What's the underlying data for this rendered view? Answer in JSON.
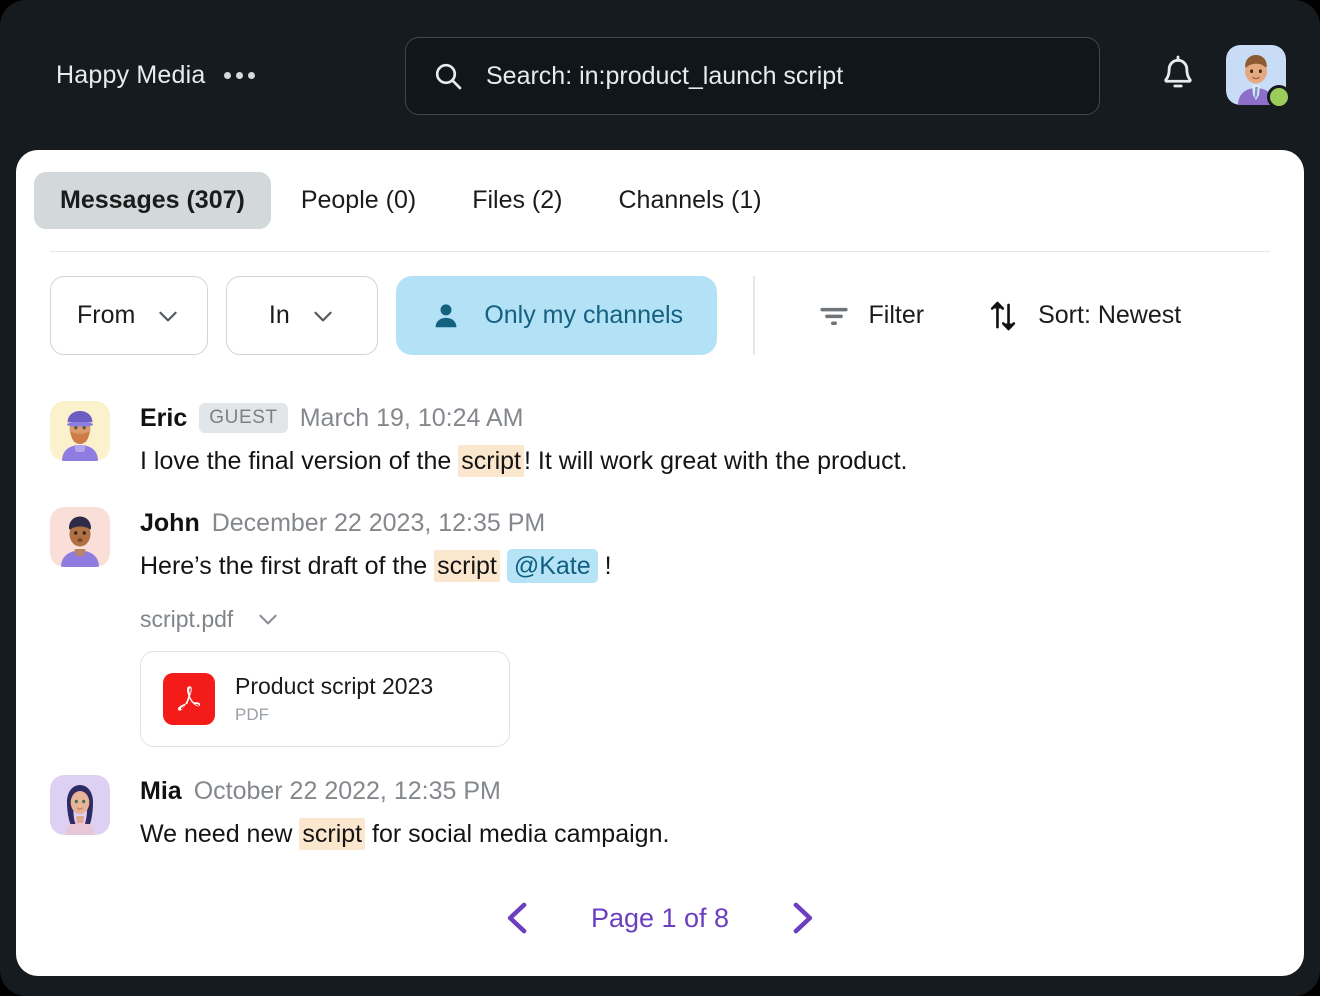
{
  "topbar": {
    "brand": "Happy Media",
    "more_icon": "more-horizontal-icon",
    "search": {
      "icon": "search-icon",
      "value": "Search: in:product_launch script"
    },
    "notifications_icon": "bell-icon",
    "avatar_name": "user-avatar",
    "status": "online"
  },
  "tabs": [
    {
      "label": "Messages (307)",
      "active": true
    },
    {
      "label": "People (0)",
      "active": false
    },
    {
      "label": "Files (2)",
      "active": false
    },
    {
      "label": "Channels (1)",
      "active": false
    }
  ],
  "filters": {
    "from_label": "From",
    "in_label": "In",
    "only_my_channels_label": "Only my channels",
    "filter_label": "Filter",
    "sort_label": "Sort: Newest"
  },
  "messages": [
    {
      "author": "Eric",
      "badge": "GUEST",
      "time": "March 19, 10:24 AM",
      "text_before": "I love the final version of the ",
      "highlight": "script",
      "text_after": "! It will work great with the product."
    },
    {
      "author": "John",
      "badge": "",
      "time": "December 22 2023, 12:35 PM",
      "text_before": "Here’s the first draft of the ",
      "highlight": "script",
      "mention": "@Kate",
      "text_after": "!",
      "filename": "script.pdf",
      "attachment": {
        "title": "Product script 2023",
        "type": "PDF"
      }
    },
    {
      "author": "Mia",
      "badge": "",
      "time": "October 22 2022, 12:35 PM",
      "text_before": "We need new ",
      "highlight": "script",
      "text_after": " for social media campaign."
    }
  ],
  "pagination": {
    "prev_icon": "chevron-left-icon",
    "label": "Page 1 of 8",
    "next_icon": "chevron-right-icon"
  },
  "colors": {
    "app_background": "#151b1f",
    "card": "#ffffff",
    "accent_purple": "#6b3fbf",
    "highlight_peach": "#fbe6ce",
    "mention_blue": "#b6e4f6",
    "chip_blue": "#b3e2f7",
    "pdf_red": "#f41c19",
    "status_green": "#9ccd5a"
  }
}
